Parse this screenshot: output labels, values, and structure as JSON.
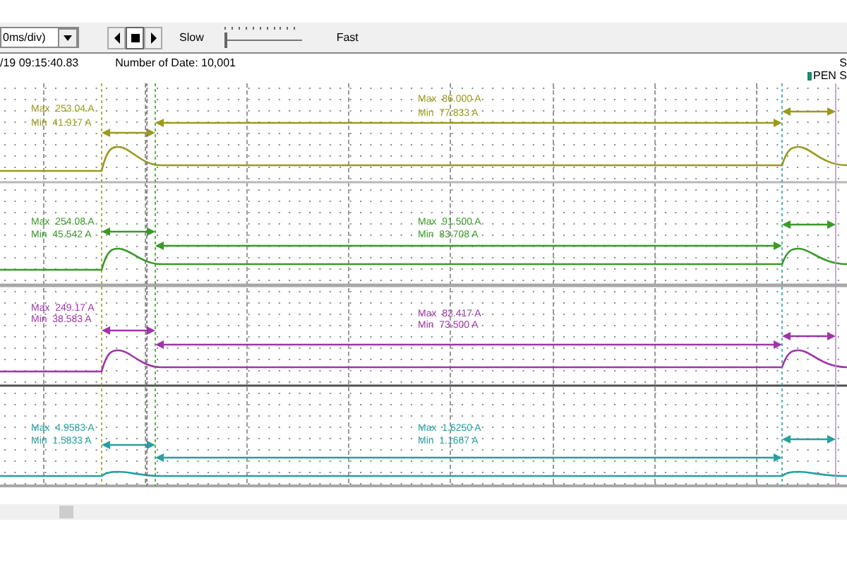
{
  "toolbar": {
    "timebase": "0ms/div)",
    "slow_label": "Slow",
    "fast_label": "Fast",
    "speed": {
      "level": 0
    }
  },
  "info_bar": {
    "timestamp": "/19 09:15:40.83",
    "data_count": "Number of Date: 10,001",
    "right_top": "S",
    "right_legend": "PEN S"
  },
  "channels": [
    {
      "color": "#9a9a1e",
      "segments": [
        {
          "max": "Max  253.04 A",
          "min": "Min  41.917 A"
        },
        {
          "max": "Max  86.000 A",
          "min": "Min  77.833 A"
        }
      ]
    },
    {
      "color": "#3a9a2a",
      "segments": [
        {
          "max": "Max  254.08 A",
          "min": "Min  45.542 A"
        },
        {
          "max": "Max  91.500 A",
          "min": "Min  83.708 A"
        }
      ]
    },
    {
      "color": "#a034a8",
      "segments": [
        {
          "max": "Max  249.17 A",
          "min": "Min  38.583 A"
        },
        {
          "max": "Max  82.417 A",
          "min": "Min  73.500 A"
        }
      ]
    },
    {
      "color": "#26a0a0",
      "segments": [
        {
          "max": "Max  4.9583 A",
          "min": "Min  1.5833 A"
        },
        {
          "max": "Max  1.6250 A",
          "min": "Min  1.1667 A"
        }
      ]
    }
  ]
}
